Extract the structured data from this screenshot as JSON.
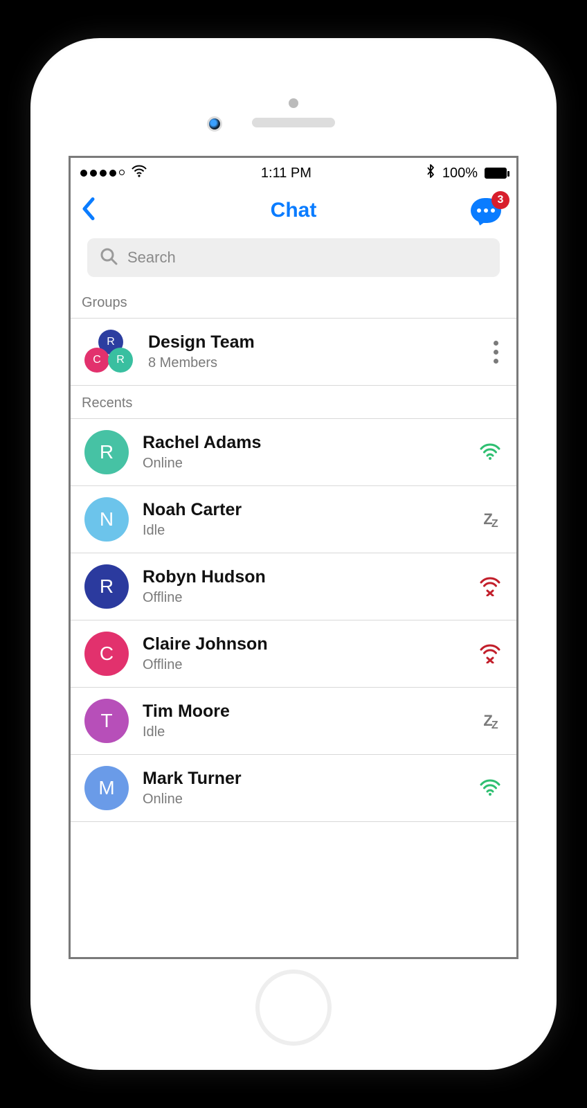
{
  "status_bar": {
    "time": "1:11 PM",
    "battery_pct": "100%"
  },
  "header": {
    "title": "Chat",
    "badge_count": "3"
  },
  "search": {
    "placeholder": "Search"
  },
  "sections": {
    "groups_label": "Groups",
    "recents_label": "Recents"
  },
  "group": {
    "name": "Design Team",
    "members": "8 Members",
    "mini_avatars": [
      {
        "initial": "R",
        "color": "#2c3ea0"
      },
      {
        "initial": "C",
        "color": "#e2316d"
      },
      {
        "initial": "R",
        "color": "#39bfa0"
      }
    ]
  },
  "recents": [
    {
      "initial": "R",
      "color": "#46c2a4",
      "name": "Rachel Adams",
      "status": "Online",
      "icon": "online"
    },
    {
      "initial": "N",
      "color": "#6cc4eb",
      "name": "Noah Carter",
      "status": "Idle",
      "icon": "idle"
    },
    {
      "initial": "R",
      "color": "#2b3a9e",
      "name": "Robyn Hudson",
      "status": "Offline",
      "icon": "offline"
    },
    {
      "initial": "C",
      "color": "#e2316d",
      "name": "Claire Johnson",
      "status": "Offline",
      "icon": "offline"
    },
    {
      "initial": "T",
      "color": "#b74fb9",
      "name": "Tim Moore",
      "status": "Idle",
      "icon": "idle"
    },
    {
      "initial": "M",
      "color": "#6a9be8",
      "name": "Mark Turner",
      "status": "Online",
      "icon": "online"
    }
  ],
  "colors": {
    "accent": "#0a7cff",
    "online": "#2fbf71",
    "offline": "#c21f2b",
    "idle": "#7a7a7a"
  }
}
